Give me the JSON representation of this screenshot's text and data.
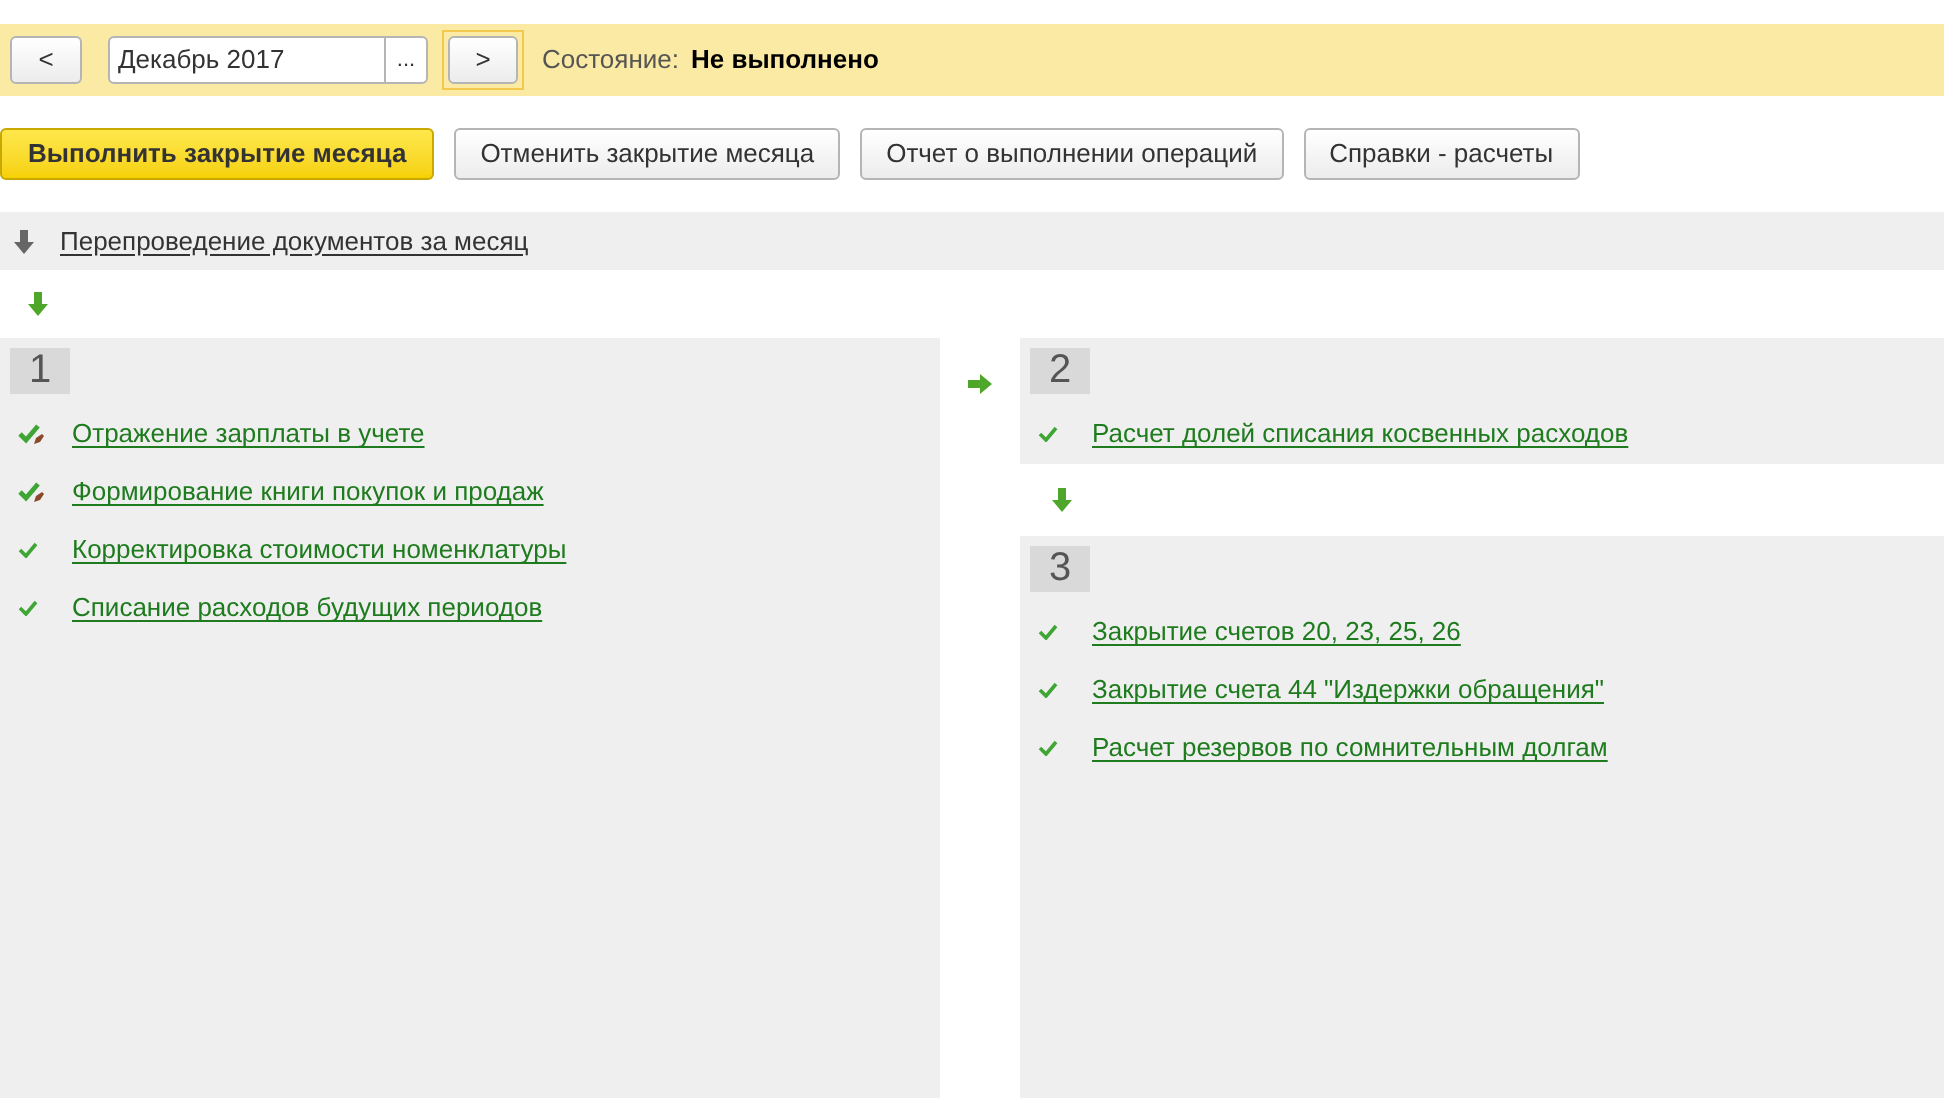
{
  "period": {
    "prev_label": "<",
    "value": "Декабрь 2017",
    "select_label": "...",
    "next_label": ">",
    "state_label": "Состояние:",
    "state_value": "Не выполнено"
  },
  "actions": [
    {
      "label": "Выполнить закрытие месяца",
      "primary": true
    },
    {
      "label": "Отменить закрытие месяца",
      "primary": false
    },
    {
      "label": "Отчет о выполнении операций",
      "primary": false
    },
    {
      "label": "Справки - расчеты",
      "primary": false
    }
  ],
  "repost": {
    "label": "Перепроведение документов за месяц"
  },
  "stages": [
    {
      "number": "1",
      "operations": [
        {
          "label": "Отражение зарплаты в учете",
          "kind": "edited"
        },
        {
          "label": "Формирование книги покупок и продаж",
          "kind": "edited"
        },
        {
          "label": "Корректировка стоимости номенклатуры",
          "kind": "done"
        },
        {
          "label": "Списание расходов будущих периодов",
          "kind": "done"
        }
      ]
    },
    {
      "number": "2",
      "operations": [
        {
          "label": "Расчет долей списания косвенных расходов",
          "kind": "done"
        }
      ]
    },
    {
      "number": "3",
      "operations": [
        {
          "label": "Закрытие счетов 20, 23, 25, 26",
          "kind": "done"
        },
        {
          "label": "Закрытие счета 44 \"Издержки обращения\"",
          "kind": "done"
        },
        {
          "label": "Расчет резервов по сомнительным долгам",
          "kind": "done"
        }
      ]
    }
  ]
}
